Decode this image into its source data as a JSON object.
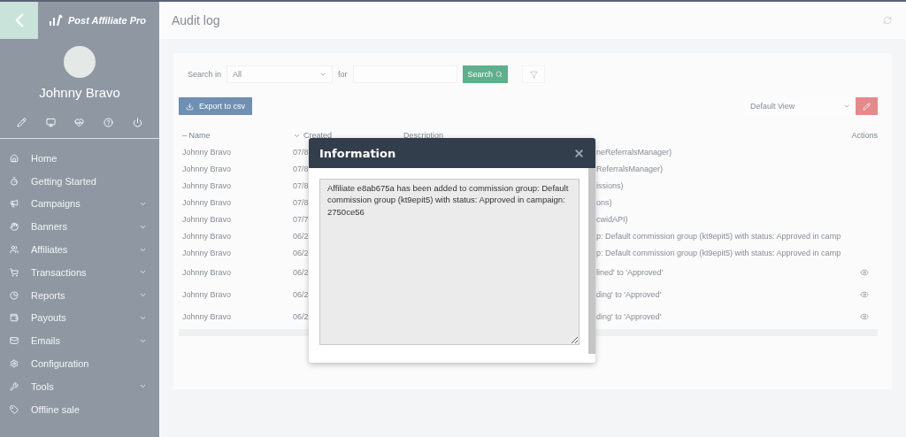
{
  "sidebar": {
    "logo": "Post Affiliate Pro",
    "user_name": "Johnny Bravo",
    "menu": [
      {
        "label": "Home",
        "has_submenu": false
      },
      {
        "label": "Getting Started",
        "has_submenu": false
      },
      {
        "label": "Campaigns",
        "has_submenu": true
      },
      {
        "label": "Banners",
        "has_submenu": true
      },
      {
        "label": "Affiliates",
        "has_submenu": true
      },
      {
        "label": "Transactions",
        "has_submenu": true
      },
      {
        "label": "Reports",
        "has_submenu": true
      },
      {
        "label": "Payouts",
        "has_submenu": true
      },
      {
        "label": "Emails",
        "has_submenu": true
      },
      {
        "label": "Configuration",
        "has_submenu": false
      },
      {
        "label": "Tools",
        "has_submenu": true
      },
      {
        "label": "Offline sale",
        "has_submenu": false
      }
    ]
  },
  "page": {
    "title": "Audit log"
  },
  "filters": {
    "search_in_label": "Search in",
    "search_in_value": "All",
    "for_label": "for",
    "search_button": "Search"
  },
  "toolbar": {
    "export_button": "Export to csv",
    "view_select": "Default View"
  },
  "table": {
    "sort_mark": "–",
    "columns": [
      "Name",
      "Created",
      "Description",
      "Actions"
    ],
    "rows": [
      {
        "name": "Johnny Bravo",
        "created": "07/8",
        "description": "neReferralsManager)",
        "has_view": false
      },
      {
        "name": "Johnny Bravo",
        "created": "07/8",
        "description": "ReferralsManager)",
        "has_view": false
      },
      {
        "name": "Johnny Bravo",
        "created": "07/8",
        "description": "issions)",
        "has_view": false
      },
      {
        "name": "Johnny Bravo",
        "created": "07/8",
        "description": "ons)",
        "has_view": false
      },
      {
        "name": "Johnny Bravo",
        "created": "07/7",
        "description": "cwidAPI)",
        "has_view": false
      },
      {
        "name": "Johnny Bravo",
        "created": "06/2",
        "description": "p: Default commission group (kt9epit5) with status: Approved in camp",
        "has_view": false
      },
      {
        "name": "Johnny Bravo",
        "created": "06/2",
        "description": "p: Default commission group (kt9epit5) with status: Approved in camp",
        "has_view": false
      },
      {
        "name": "Johnny Bravo",
        "created": "06/2",
        "description": "lined' to 'Approved'",
        "has_view": true
      },
      {
        "name": "Johnny Bravo",
        "created": "06/2",
        "description": "ding' to 'Approved'",
        "has_view": true
      },
      {
        "name": "Johnny Bravo",
        "created": "06/2",
        "description": "ding' to 'Approved'",
        "has_view": true
      }
    ]
  },
  "dialog": {
    "title": "Information",
    "message": "Affiliate e8ab675a has been added to commission group: Default commission group (kt9epit5) with status: Approved in campaign: 2750ce56"
  }
}
